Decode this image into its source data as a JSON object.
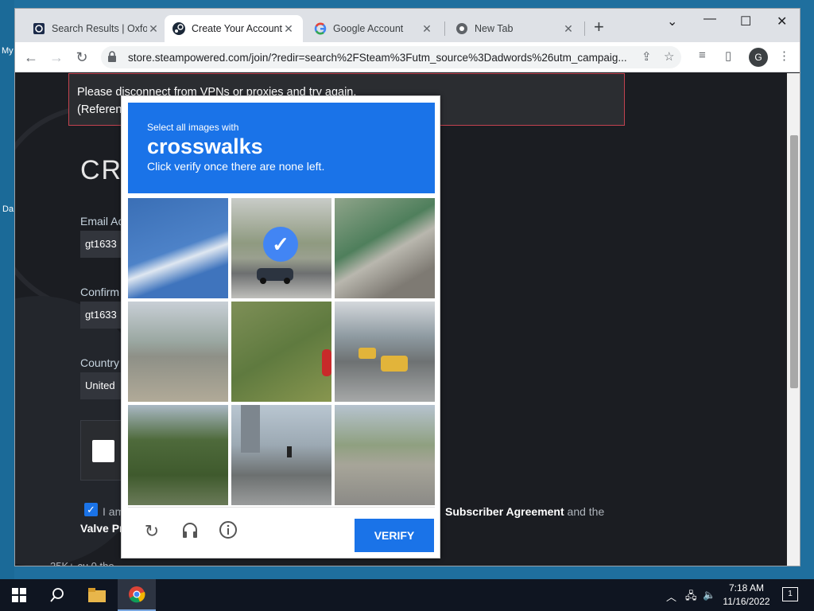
{
  "desktop": {
    "label_my": "My",
    "label_da": "Da"
  },
  "browser": {
    "tabs": [
      {
        "title": "Search Results | Oxfor",
        "favicon": "oxford-icon"
      },
      {
        "title": "Create Your Account",
        "favicon": "steam-icon",
        "active": true
      },
      {
        "title": "Google Account",
        "favicon": "google-icon"
      },
      {
        "title": "New Tab",
        "favicon": "chrome-icon"
      }
    ],
    "url": "store.steampowered.com/join/?redir=search%2FSteam%3Futm_source%3Dadwords%26utm_campaig...",
    "profile_initial": "G"
  },
  "page": {
    "error_line1": "Please disconnect from VPNs or proxies and try again.",
    "error_line2": "(Referen",
    "heading_partial": "CR",
    "email_label": "Email Ac",
    "email_value": "gt1633",
    "confirm_label": "Confirm",
    "confirm_value": "gt1633",
    "country_label": "Country",
    "country_value": "United",
    "agree_prefix": "I am",
    "agree_link1": "Subscriber Agreement",
    "agree_and": "and the",
    "agree_link2": "Valve Pr",
    "bottom_partial": "25K+ cu     0     the"
  },
  "captcha": {
    "instruction_small": "Select all images with",
    "target": "crosswalks",
    "instruction_sub": "Click verify once there are none left.",
    "tiles_selected": [
      false,
      true,
      false,
      false,
      false,
      false,
      false,
      false,
      false
    ],
    "verify_label": "VERIFY"
  },
  "taskbar": {
    "time": "7:18 AM",
    "date": "11/16/2022",
    "notifications": "1"
  }
}
